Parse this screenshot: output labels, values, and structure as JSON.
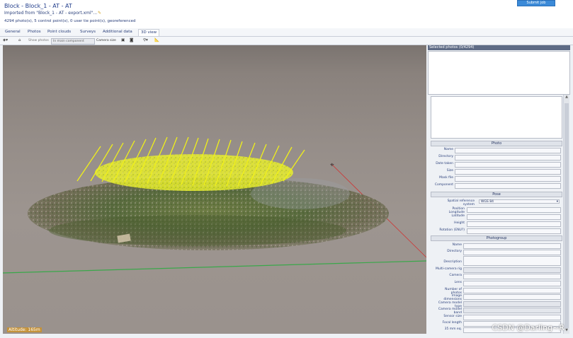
{
  "header": {
    "title": "Block - Block_1 - AT - AT",
    "imported": "Imported from \"Block_1 - AT - export.xml\"...",
    "summary": "4294 photo(s), 5 control point(s), 0 user tie point(s), georeferenced",
    "top_button": "Submit job"
  },
  "tabs": [
    "General",
    "Photos",
    "Point clouds",
    "Surveys",
    "Additional data",
    "3D view"
  ],
  "toolbar": {
    "show_photos": "Show photos",
    "component_select": "In main component",
    "camera_size": "Camera size"
  },
  "viewport": {
    "altitude": "Altitude: 165m"
  },
  "side": {
    "selected_header": "Selected photos (0/4294)",
    "photo_section": "Photo",
    "photo_fields": [
      "Name",
      "Directory",
      "Date taken",
      "Size",
      "Mask file",
      "Component"
    ],
    "pose_section": "Pose",
    "pose_fields": [
      "Spatial reference system",
      "Position Longitude",
      "Latitude",
      "Height",
      "Rotation (ENU?)"
    ],
    "srs_value": "WGS 84",
    "photogroup_section": "Photogroup",
    "photogroup_fields": [
      "Name",
      "Directory",
      "Description",
      "Multi-camera rig",
      "Camera",
      "Lens",
      "Number of photos",
      "Image dimensions",
      "Camera model type",
      "Camera model band",
      "Sensor size",
      "Focal length",
      "35 mm eq."
    ]
  },
  "watermark": "CSDN @Darling~R",
  "colors": {
    "accent": "#3b8ad8",
    "camera_lines": "#f0f01a",
    "ground_line": "#3aa84a"
  }
}
